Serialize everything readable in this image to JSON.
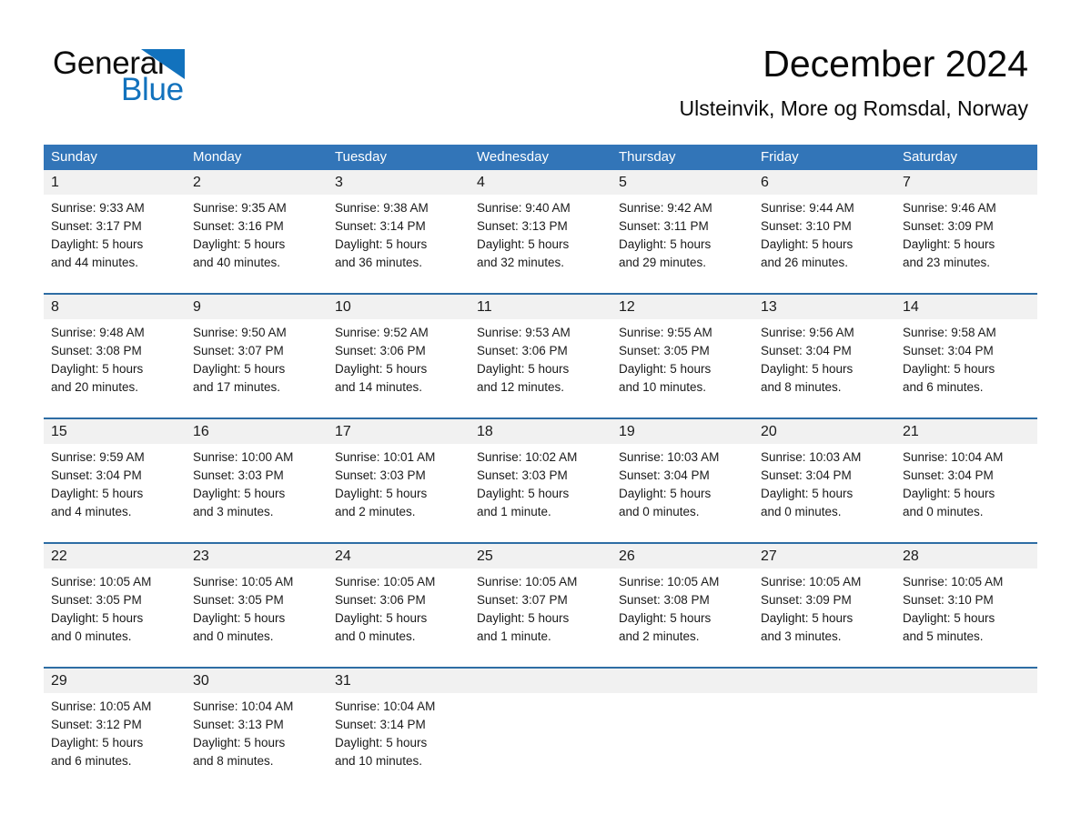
{
  "brand": {
    "name_part1": "General",
    "name_part2": "Blue",
    "triangle_color": "#1272bd",
    "icon": "triangle-logo"
  },
  "header": {
    "title": "December 2024",
    "subtitle": "Ulsteinvik, More og Romsdal, Norway"
  },
  "theme": {
    "header_blue": "#3275b8",
    "separator_blue": "#2e6da4",
    "daynum_bg": "#f1f1f1",
    "text": "#1a1a1a"
  },
  "calendar": {
    "weekday_headers": [
      "Sunday",
      "Monday",
      "Tuesday",
      "Wednesday",
      "Thursday",
      "Friday",
      "Saturday"
    ],
    "weeks": [
      [
        {
          "day": "1",
          "sunrise": "Sunrise: 9:33 AM",
          "sunset": "Sunset: 3:17 PM",
          "daylight_line1": "Daylight: 5 hours",
          "daylight_line2": "and 44 minutes."
        },
        {
          "day": "2",
          "sunrise": "Sunrise: 9:35 AM",
          "sunset": "Sunset: 3:16 PM",
          "daylight_line1": "Daylight: 5 hours",
          "daylight_line2": "and 40 minutes."
        },
        {
          "day": "3",
          "sunrise": "Sunrise: 9:38 AM",
          "sunset": "Sunset: 3:14 PM",
          "daylight_line1": "Daylight: 5 hours",
          "daylight_line2": "and 36 minutes."
        },
        {
          "day": "4",
          "sunrise": "Sunrise: 9:40 AM",
          "sunset": "Sunset: 3:13 PM",
          "daylight_line1": "Daylight: 5 hours",
          "daylight_line2": "and 32 minutes."
        },
        {
          "day": "5",
          "sunrise": "Sunrise: 9:42 AM",
          "sunset": "Sunset: 3:11 PM",
          "daylight_line1": "Daylight: 5 hours",
          "daylight_line2": "and 29 minutes."
        },
        {
          "day": "6",
          "sunrise": "Sunrise: 9:44 AM",
          "sunset": "Sunset: 3:10 PM",
          "daylight_line1": "Daylight: 5 hours",
          "daylight_line2": "and 26 minutes."
        },
        {
          "day": "7",
          "sunrise": "Sunrise: 9:46 AM",
          "sunset": "Sunset: 3:09 PM",
          "daylight_line1": "Daylight: 5 hours",
          "daylight_line2": "and 23 minutes."
        }
      ],
      [
        {
          "day": "8",
          "sunrise": "Sunrise: 9:48 AM",
          "sunset": "Sunset: 3:08 PM",
          "daylight_line1": "Daylight: 5 hours",
          "daylight_line2": "and 20 minutes."
        },
        {
          "day": "9",
          "sunrise": "Sunrise: 9:50 AM",
          "sunset": "Sunset: 3:07 PM",
          "daylight_line1": "Daylight: 5 hours",
          "daylight_line2": "and 17 minutes."
        },
        {
          "day": "10",
          "sunrise": "Sunrise: 9:52 AM",
          "sunset": "Sunset: 3:06 PM",
          "daylight_line1": "Daylight: 5 hours",
          "daylight_line2": "and 14 minutes."
        },
        {
          "day": "11",
          "sunrise": "Sunrise: 9:53 AM",
          "sunset": "Sunset: 3:06 PM",
          "daylight_line1": "Daylight: 5 hours",
          "daylight_line2": "and 12 minutes."
        },
        {
          "day": "12",
          "sunrise": "Sunrise: 9:55 AM",
          "sunset": "Sunset: 3:05 PM",
          "daylight_line1": "Daylight: 5 hours",
          "daylight_line2": "and 10 minutes."
        },
        {
          "day": "13",
          "sunrise": "Sunrise: 9:56 AM",
          "sunset": "Sunset: 3:04 PM",
          "daylight_line1": "Daylight: 5 hours",
          "daylight_line2": "and 8 minutes."
        },
        {
          "day": "14",
          "sunrise": "Sunrise: 9:58 AM",
          "sunset": "Sunset: 3:04 PM",
          "daylight_line1": "Daylight: 5 hours",
          "daylight_line2": "and 6 minutes."
        }
      ],
      [
        {
          "day": "15",
          "sunrise": "Sunrise: 9:59 AM",
          "sunset": "Sunset: 3:04 PM",
          "daylight_line1": "Daylight: 5 hours",
          "daylight_line2": "and 4 minutes."
        },
        {
          "day": "16",
          "sunrise": "Sunrise: 10:00 AM",
          "sunset": "Sunset: 3:03 PM",
          "daylight_line1": "Daylight: 5 hours",
          "daylight_line2": "and 3 minutes."
        },
        {
          "day": "17",
          "sunrise": "Sunrise: 10:01 AM",
          "sunset": "Sunset: 3:03 PM",
          "daylight_line1": "Daylight: 5 hours",
          "daylight_line2": "and 2 minutes."
        },
        {
          "day": "18",
          "sunrise": "Sunrise: 10:02 AM",
          "sunset": "Sunset: 3:03 PM",
          "daylight_line1": "Daylight: 5 hours",
          "daylight_line2": "and 1 minute."
        },
        {
          "day": "19",
          "sunrise": "Sunrise: 10:03 AM",
          "sunset": "Sunset: 3:04 PM",
          "daylight_line1": "Daylight: 5 hours",
          "daylight_line2": "and 0 minutes."
        },
        {
          "day": "20",
          "sunrise": "Sunrise: 10:03 AM",
          "sunset": "Sunset: 3:04 PM",
          "daylight_line1": "Daylight: 5 hours",
          "daylight_line2": "and 0 minutes."
        },
        {
          "day": "21",
          "sunrise": "Sunrise: 10:04 AM",
          "sunset": "Sunset: 3:04 PM",
          "daylight_line1": "Daylight: 5 hours",
          "daylight_line2": "and 0 minutes."
        }
      ],
      [
        {
          "day": "22",
          "sunrise": "Sunrise: 10:05 AM",
          "sunset": "Sunset: 3:05 PM",
          "daylight_line1": "Daylight: 5 hours",
          "daylight_line2": "and 0 minutes."
        },
        {
          "day": "23",
          "sunrise": "Sunrise: 10:05 AM",
          "sunset": "Sunset: 3:05 PM",
          "daylight_line1": "Daylight: 5 hours",
          "daylight_line2": "and 0 minutes."
        },
        {
          "day": "24",
          "sunrise": "Sunrise: 10:05 AM",
          "sunset": "Sunset: 3:06 PM",
          "daylight_line1": "Daylight: 5 hours",
          "daylight_line2": "and 0 minutes."
        },
        {
          "day": "25",
          "sunrise": "Sunrise: 10:05 AM",
          "sunset": "Sunset: 3:07 PM",
          "daylight_line1": "Daylight: 5 hours",
          "daylight_line2": "and 1 minute."
        },
        {
          "day": "26",
          "sunrise": "Sunrise: 10:05 AM",
          "sunset": "Sunset: 3:08 PM",
          "daylight_line1": "Daylight: 5 hours",
          "daylight_line2": "and 2 minutes."
        },
        {
          "day": "27",
          "sunrise": "Sunrise: 10:05 AM",
          "sunset": "Sunset: 3:09 PM",
          "daylight_line1": "Daylight: 5 hours",
          "daylight_line2": "and 3 minutes."
        },
        {
          "day": "28",
          "sunrise": "Sunrise: 10:05 AM",
          "sunset": "Sunset: 3:10 PM",
          "daylight_line1": "Daylight: 5 hours",
          "daylight_line2": "and 5 minutes."
        }
      ],
      [
        {
          "day": "29",
          "sunrise": "Sunrise: 10:05 AM",
          "sunset": "Sunset: 3:12 PM",
          "daylight_line1": "Daylight: 5 hours",
          "daylight_line2": "and 6 minutes."
        },
        {
          "day": "30",
          "sunrise": "Sunrise: 10:04 AM",
          "sunset": "Sunset: 3:13 PM",
          "daylight_line1": "Daylight: 5 hours",
          "daylight_line2": "and 8 minutes."
        },
        {
          "day": "31",
          "sunrise": "Sunrise: 10:04 AM",
          "sunset": "Sunset: 3:14 PM",
          "daylight_line1": "Daylight: 5 hours",
          "daylight_line2": "and 10 minutes."
        },
        {
          "day": "",
          "sunrise": "",
          "sunset": "",
          "daylight_line1": "",
          "daylight_line2": ""
        },
        {
          "day": "",
          "sunrise": "",
          "sunset": "",
          "daylight_line1": "",
          "daylight_line2": ""
        },
        {
          "day": "",
          "sunrise": "",
          "sunset": "",
          "daylight_line1": "",
          "daylight_line2": ""
        },
        {
          "day": "",
          "sunrise": "",
          "sunset": "",
          "daylight_line1": "",
          "daylight_line2": ""
        }
      ]
    ]
  }
}
